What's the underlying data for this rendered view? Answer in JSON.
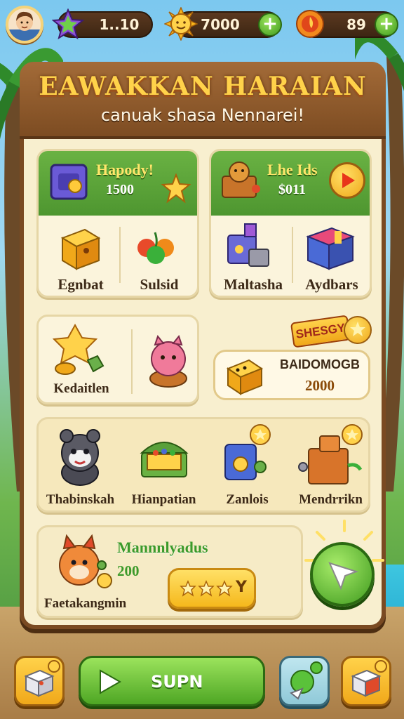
{
  "topbar": {
    "level_value": "1..10",
    "coins_value": "7000",
    "gems_value": "89"
  },
  "header": {
    "title": "EAWAKKAN HARAIAN",
    "subtitle": "canuak shasa Nennarei!"
  },
  "shop_left": {
    "banner_title": "Hapody!",
    "banner_value": "1500",
    "items": [
      {
        "label": "Egnbat"
      },
      {
        "label": "Sulsid"
      }
    ]
  },
  "shop_right": {
    "banner_title": "Lhe Ids",
    "banner_value": "$011",
    "items": [
      {
        "label": "Maltasha"
      },
      {
        "label": "Aydbars"
      }
    ]
  },
  "mid_card": {
    "label": "Kedaitlen"
  },
  "special_offer": {
    "tag": "SHESGY",
    "name": "BAIDOMOGB",
    "price": "2000"
  },
  "characters": {
    "items": [
      {
        "label": "Thabinskah"
      },
      {
        "label": "Hianpatian"
      },
      {
        "label": "Zanlois"
      },
      {
        "label": "Mendrrikn"
      }
    ]
  },
  "reward_card": {
    "title": "Mannnlyadus",
    "value": "200",
    "label": "Faetakangmin",
    "button_label": "Y"
  },
  "bottom": {
    "play_label": "SUPN"
  },
  "colors": {
    "wood": "#7a4a22",
    "parchment": "#f8efcf",
    "green": "#4e9630",
    "gold": "#ffd24a"
  }
}
